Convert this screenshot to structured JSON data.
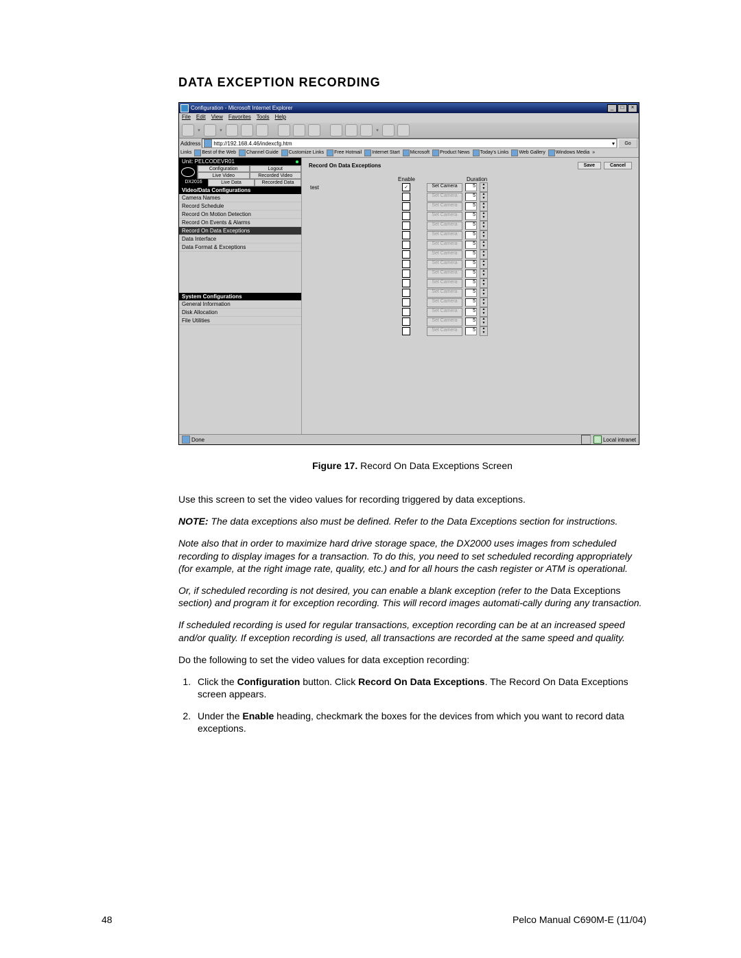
{
  "heading": "DATA EXCEPTION RECORDING",
  "figure_caption_label": "Figure 17.",
  "figure_caption_text": "Record On Data Exceptions Screen",
  "intro_text": "Use this screen to set the video values for recording triggered by data exceptions.",
  "note_label": "NOTE:",
  "note_text": "The data exceptions also must be defined. Refer to the Data Exceptions section for instructions.",
  "para2": "Note also that in order to maximize hard drive storage space, the DX2000 uses images from scheduled recording to display images for a transaction. To do this, you need to set scheduled recording appropriately (for example, at the right image rate, quality, etc.) and for all hours the cash register or ATM is operational.",
  "para3_a": "Or, if scheduled recording is not desired, you can enable a blank exception (refer to the ",
  "para3_b": "Data Exceptions",
  "para3_c": " section) and program it for exception recording. This will record images automati-cally during any transaction.",
  "para4": "If scheduled recording is used for regular transactions, exception recording can be at an increased speed and/or quality. If exception recording is used, all transactions are recorded at the same speed and quality.",
  "para5": "Do the following to set the video values for data exception recording:",
  "step1_a": "Click the ",
  "step1_b": "Configuration",
  "step1_c": " button. Click ",
  "step1_d": "Record On Data Exceptions",
  "step1_e": ". The Record On Data Exceptions screen appears.",
  "step2_a": "Under the ",
  "step2_b": "Enable",
  "step2_c": " heading, checkmark the boxes for the devices from which you want to record data exceptions.",
  "page_number": "48",
  "manual_ref": "Pelco Manual C690M-E (11/04)",
  "screenshot": {
    "title_text": "Configuration - Microsoft Internet Explorer",
    "menus": {
      "file": "File",
      "edit": "Edit",
      "view": "View",
      "favorites": "Favorites",
      "tools": "Tools",
      "help": "Help"
    },
    "address_label": "Address",
    "address_value": "http://192.168.4.46/indexcfg.htm",
    "go_label": "Go",
    "links_label": "Links",
    "links": [
      "Best of the Web",
      "Channel Guide",
      "Customize Links",
      "Free Hotmail",
      "Internet Start",
      "Microsoft",
      "Product News",
      "Today's Links",
      "Web Gallery",
      "Windows Media"
    ],
    "unit_label": "Unit: PELCODEVR01",
    "cfg_btns": {
      "cfg": "Configuration",
      "logout": "Logout",
      "live": "Live Video",
      "rec": "Recorded Video"
    },
    "model_label": "DX2016",
    "model_btns": {
      "livedata": "Live Data",
      "recdata": "Recorded Data"
    },
    "sidebar_header1": "Video/Data Configurations",
    "sidebar_items1": [
      "Camera Names",
      "Record Schedule",
      "Record On Motion Detection",
      "Record On Events & Alarms",
      "Record On Data Exceptions",
      "Data Interface",
      "Data Format & Exceptions"
    ],
    "sidebar_header2": "System Configurations",
    "sidebar_items2": [
      "General Information",
      "Disk Allocation",
      "File Utilities"
    ],
    "panel_title": "Record On Data Exceptions",
    "save_label": "Save",
    "cancel_label": "Cancel",
    "col_enable": "Enable",
    "col_duration": "Duration",
    "row_name_1": "test",
    "setcam_label": "Set Camera",
    "dur_value": "5",
    "status_done": "Done",
    "status_zone": "Local intranet"
  }
}
